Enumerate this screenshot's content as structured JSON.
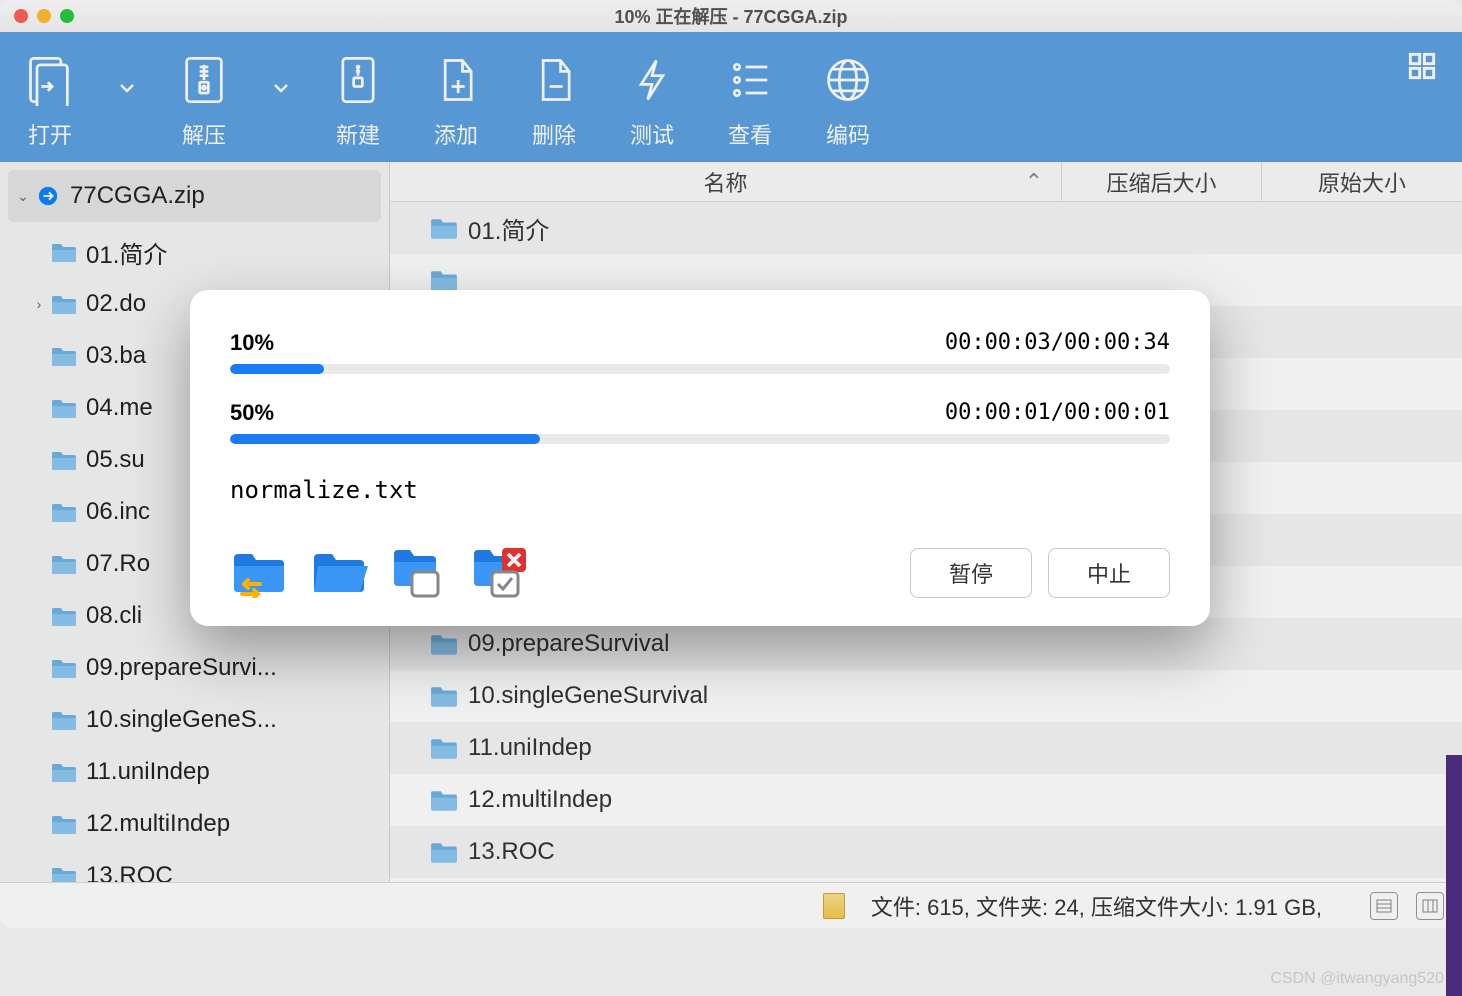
{
  "title": "10% 正在解压 - 77CGGA.zip",
  "toolbar": {
    "open": "打开",
    "extract": "解压",
    "new": "新建",
    "add": "添加",
    "delete": "删除",
    "test": "测试",
    "view": "查看",
    "encoding": "编码"
  },
  "columns": {
    "name": "名称",
    "csize": "压缩后大小",
    "osize": "原始大小"
  },
  "tree": {
    "root": "77CGGA.zip",
    "items": [
      "01.简介",
      "02.do",
      "03.ba",
      "04.me",
      "05.su",
      "06.inc",
      "07.Ro",
      "08.cli",
      "09.prepareSurvi...",
      "10.singleGeneS...",
      "11.uniIndep",
      "12.multiIndep",
      "13.ROC"
    ]
  },
  "files": [
    "01.简介",
    "09.prepareSurvival",
    "10.singleGeneSurvival",
    "11.uniIndep",
    "12.multiIndep",
    "13.ROC"
  ],
  "status": "文件: 615, 文件夹: 24, 压缩文件大小: 1.91 GB,",
  "dialog": {
    "p1_pct": "10%",
    "p1_time": "00:00:03/00:00:34",
    "p1_fill": 10,
    "p2_pct": "50%",
    "p2_time": "00:00:01/00:00:01",
    "p2_fill": 33,
    "current_file": "normalize.txt",
    "pause": "暂停",
    "stop": "中止"
  },
  "watermark": "CSDN @itwangyang520"
}
